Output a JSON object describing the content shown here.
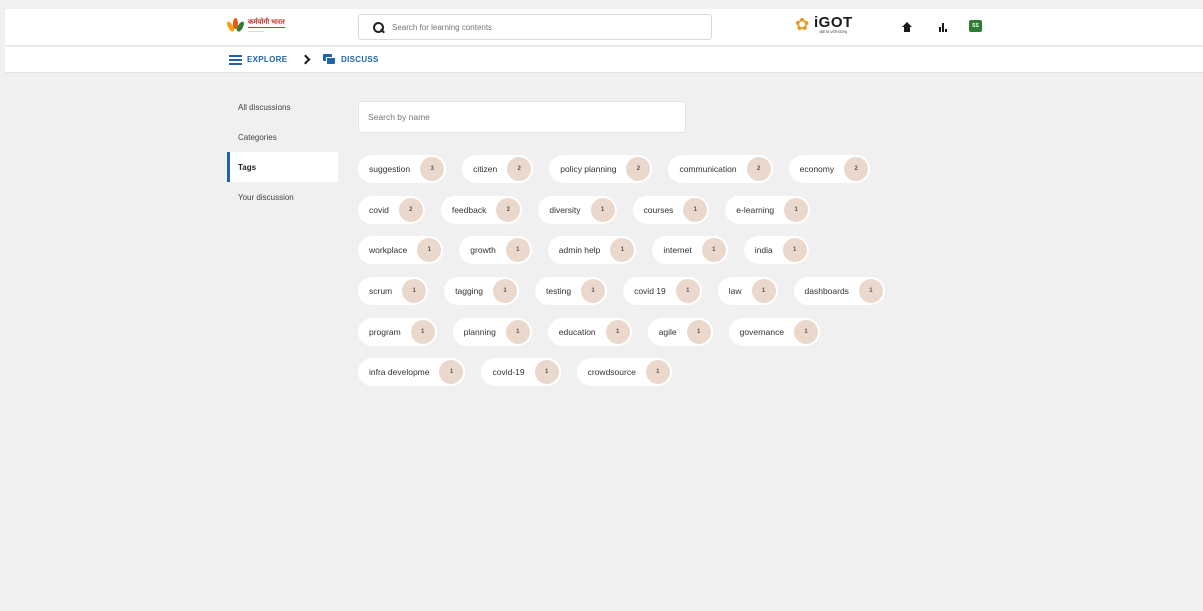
{
  "header": {
    "logo_text": "कर्मयोगी भारत",
    "logo_sub": "————",
    "search_placeholder": "Search for learning contents",
    "brand": "iGOT",
    "brand_sub": "(BETA VERSION)",
    "avatar_initials": "SS"
  },
  "breadcrumb": {
    "explore": "EXPLORE",
    "discuss": "DISCUSS"
  },
  "sidebar": {
    "items": [
      {
        "label": "All discussions",
        "active": false
      },
      {
        "label": "Categories",
        "active": false
      },
      {
        "label": "Tags",
        "active": true
      },
      {
        "label": "Your discussion",
        "active": false
      }
    ]
  },
  "main": {
    "search_placeholder": "Search by name",
    "tag_rows": [
      [
        {
          "name": "suggestion",
          "count": "3"
        },
        {
          "name": "citizen",
          "count": "2"
        },
        {
          "name": "policy planning",
          "count": "2"
        },
        {
          "name": "communication",
          "count": "2"
        },
        {
          "name": "economy",
          "count": "2"
        }
      ],
      [
        {
          "name": "covid",
          "count": "2"
        },
        {
          "name": "feedback",
          "count": "2"
        },
        {
          "name": "diversity",
          "count": "1"
        },
        {
          "name": "courses",
          "count": "1"
        },
        {
          "name": "e-learning",
          "count": "1"
        }
      ],
      [
        {
          "name": "workplace",
          "count": "1"
        },
        {
          "name": "growth",
          "count": "1"
        },
        {
          "name": "admin help",
          "count": "1"
        },
        {
          "name": "internet",
          "count": "1"
        },
        {
          "name": "india",
          "count": "1"
        }
      ],
      [
        {
          "name": "scrum",
          "count": "1"
        },
        {
          "name": "tagging",
          "count": "1"
        },
        {
          "name": "testing",
          "count": "1"
        },
        {
          "name": "covid 19",
          "count": "1"
        },
        {
          "name": "law",
          "count": "1"
        },
        {
          "name": "dashboards",
          "count": "1"
        }
      ],
      [
        {
          "name": "program",
          "count": "1"
        },
        {
          "name": "planning",
          "count": "1"
        },
        {
          "name": "education",
          "count": "1"
        },
        {
          "name": "agile",
          "count": "1"
        },
        {
          "name": "governance",
          "count": "1"
        }
      ],
      [
        {
          "name": "infra developme",
          "count": "1"
        },
        {
          "name": "covid-19",
          "count": "1"
        },
        {
          "name": "crowdsource",
          "count": "1"
        }
      ]
    ]
  },
  "colors": {
    "accent": "#1f63ad",
    "tag_count_bg": "#ead8cc",
    "page_bg": "#f0f0f0"
  }
}
